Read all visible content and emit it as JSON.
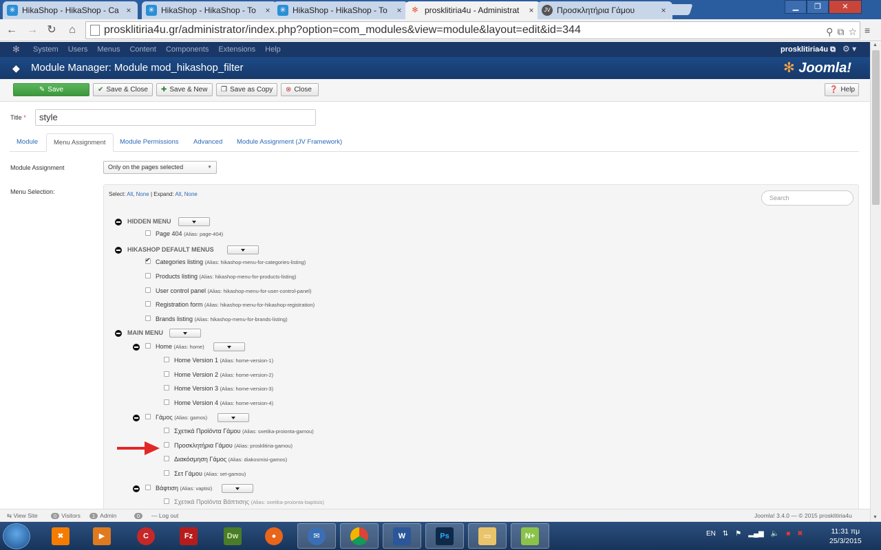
{
  "browser": {
    "tabs": [
      {
        "title": "HikaShop - HikaShop - Ca",
        "active": false
      },
      {
        "title": "HikaShop - HikaShop - To",
        "active": false
      },
      {
        "title": "HikaShop - HikaShop - To",
        "active": false
      },
      {
        "title": "prosklitiria4u - Administrat",
        "active": true
      },
      {
        "title": "Προσκλητήρια Γάμου",
        "active": false
      }
    ],
    "url": "prosklitiria4u.gr/administrator/index.php?option=com_modules&view=module&layout=edit&id=344"
  },
  "joomla": {
    "nav": [
      "System",
      "Users",
      "Menus",
      "Content",
      "Components",
      "Extensions",
      "Help"
    ],
    "user": "prosklitiria4u",
    "page_title": "Module Manager: Module mod_hikashop_filter",
    "brand": "Joomla!",
    "toolbar": {
      "save": "Save",
      "save_close": "Save & Close",
      "save_new": "Save & New",
      "save_copy": "Save as Copy",
      "close": "Close",
      "help": "Help"
    },
    "form": {
      "title_label": "Title",
      "title_required": "*",
      "title_value": "style",
      "tabs": [
        "Module",
        "Menu Assignment",
        "Module Permissions",
        "Advanced",
        "Module Assignment (JV Framework)"
      ],
      "active_tab": "Menu Assignment",
      "assignment_label": "Module Assignment",
      "assignment_value": "Only on the pages selected",
      "menu_selection_label": "Menu Selection:",
      "select_text": "Select:",
      "select_all": "All",
      "select_none": "None",
      "expand_text": "Expand:",
      "expand_all": "All",
      "expand_none": "None",
      "search_placeholder": "Search"
    },
    "menus": {
      "hidden": {
        "name": "HIDDEN MENU",
        "items": [
          {
            "label": "Page 404",
            "alias": "(Alias: page-404)"
          }
        ]
      },
      "hikashop": {
        "name": "HIKASHOP DEFAULT MENUS",
        "items": [
          {
            "label": "Categories listing",
            "alias": "(Alias: hikashop-menu-for-categories-listing)",
            "checked": true
          },
          {
            "label": "Products listing",
            "alias": "(Alias: hikashop-menu-for-products-listing)"
          },
          {
            "label": "User control panel",
            "alias": "(Alias: hikashop-menu-for-user-control-panel)"
          },
          {
            "label": "Registration form",
            "alias": "(Alias: hikashop-menu-for-hikashop-registration)"
          },
          {
            "label": "Brands listing",
            "alias": "(Alias: hikashop-menu-for-brands-listing)"
          }
        ]
      },
      "main": {
        "name": "MAIN MENU",
        "home": {
          "label": "Home",
          "alias": "(Alias: home)"
        },
        "home_children": [
          {
            "label": "Home Version 1",
            "alias": "(Alias: home-version-1)"
          },
          {
            "label": "Home Version 2",
            "alias": "(Alias: home-version-2)"
          },
          {
            "label": "Home Version 3",
            "alias": "(Alias: home-version-3)"
          },
          {
            "label": "Home Version 4",
            "alias": "(Alias: home-version-4)"
          }
        ],
        "gamos": {
          "label": "Γάμος",
          "alias": "(Alias: gamos)"
        },
        "gamos_children": [
          {
            "label": "Σχετικά Προϊόντα Γάμου",
            "alias": "(Alias: sxetika-proionta-gamou)"
          },
          {
            "label": "Προσκλητήρια Γάμου",
            "alias": "(Alias: prosklitiria-gamou)"
          },
          {
            "label": "Διακόσμηση Γάμος",
            "alias": "(Alias: diakosmisi-gamos)"
          },
          {
            "label": "Σετ Γάμου",
            "alias": "(Alias: set-gamou)"
          }
        ],
        "vaptisi": {
          "label": "Βάφτιση",
          "alias": "(Alias: vaptisi)"
        },
        "vaptisi_child": {
          "label": "Σχετικά Προϊόντα Βάπτισης",
          "alias": "(Alias: sxetika-proionta-baptisis)"
        }
      }
    },
    "status": {
      "view_site": "View Site",
      "visitors_count": "0",
      "visitors": "Visitors",
      "admin_count": "1",
      "admin": "Admin",
      "messages_count": "0",
      "logout": "Log out",
      "version": "Joomla! 3.4.0 — © 2015 prosklitiria4u"
    }
  },
  "taskbar": {
    "apps": [
      "XAMPP",
      "Media",
      "CCleaner",
      "FileZilla",
      "Dw",
      "Firefox",
      "Thunderbird",
      "Chrome",
      "Word",
      "Ps",
      "Explorer",
      "Notepad++"
    ],
    "language": "EN",
    "time": "11:31 πμ",
    "date": "25/3/2015"
  },
  "colors": {
    "tabbar": "#2a5d9f",
    "joomla_header": "#1c4a86",
    "save_green": "#5bb75b",
    "link_blue": "#2a69b8",
    "arrow_red": "#e32626"
  }
}
